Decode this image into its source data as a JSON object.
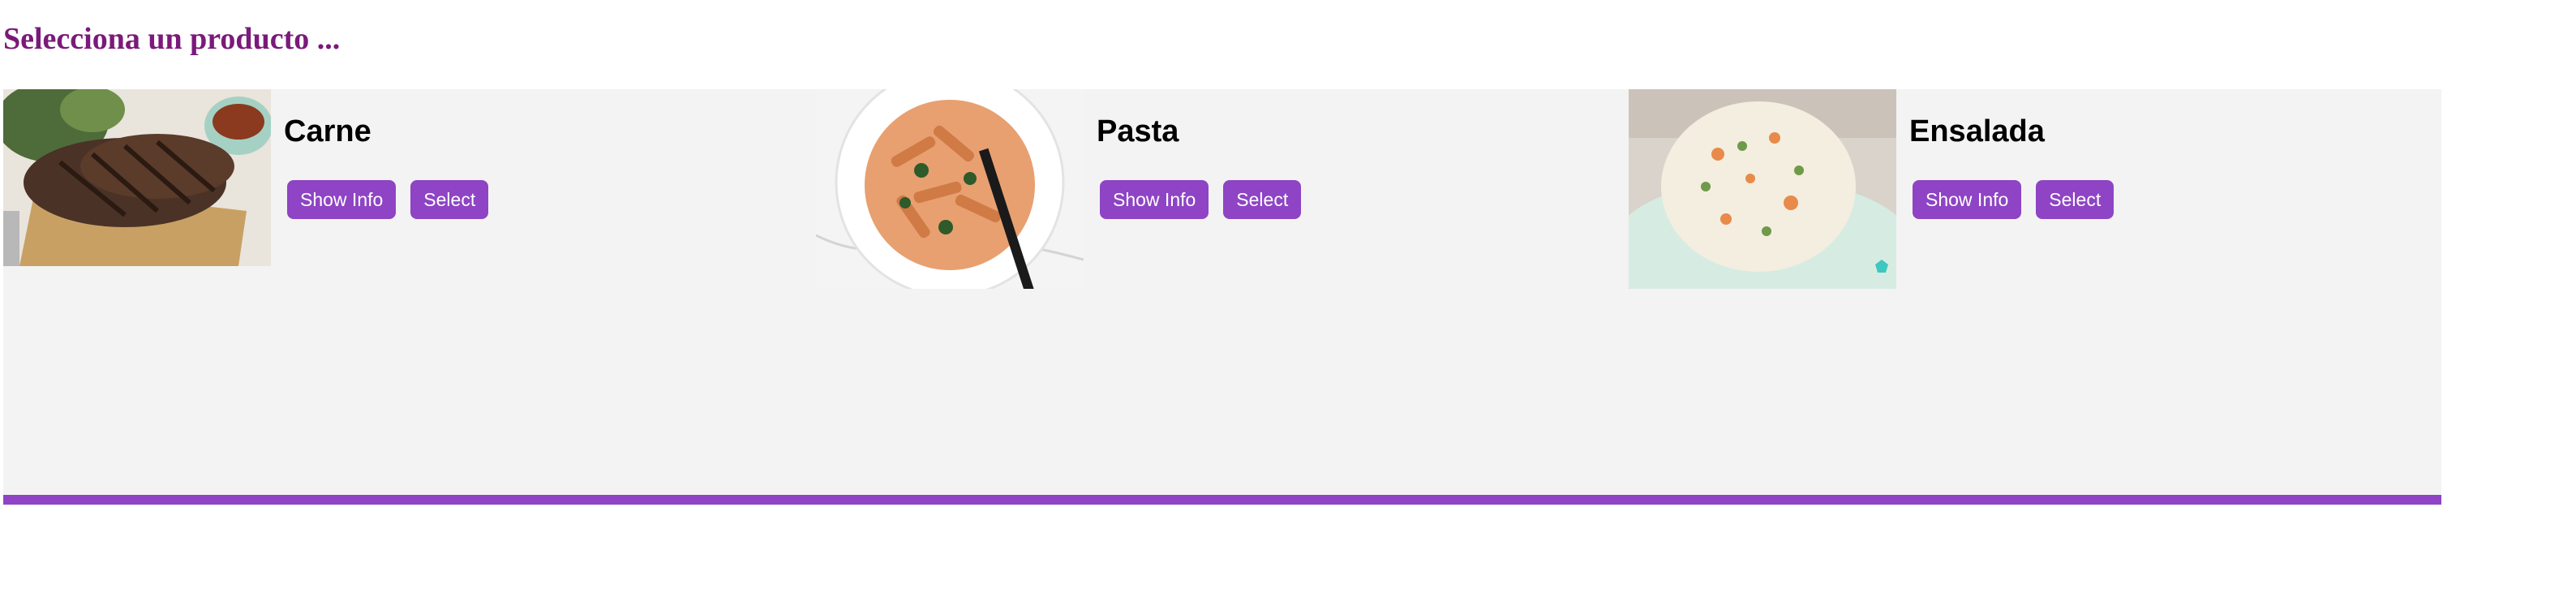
{
  "page": {
    "title": "Selecciona un producto ..."
  },
  "colors": {
    "accent": "#8e44c4",
    "title": "#7a1a7a",
    "panel_background": "#f3f3f3"
  },
  "products": [
    {
      "name": "Carne",
      "image_subject": "grilled steak on wooden board",
      "show_info_label": "Show Info",
      "select_label": "Select"
    },
    {
      "name": "Pasta",
      "image_subject": "penne pasta in white bowl",
      "show_info_label": "Show Info",
      "select_label": "Select"
    },
    {
      "name": "Ensalada",
      "image_subject": "russian salad on plate",
      "show_info_label": "Show Info",
      "select_label": "Select"
    }
  ]
}
